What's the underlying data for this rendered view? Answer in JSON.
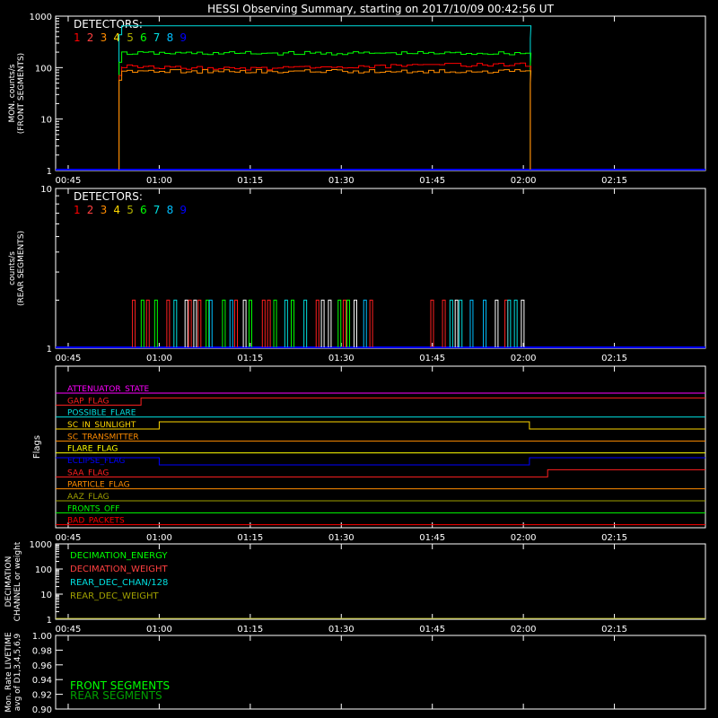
{
  "title": "HESSI Observing Summary, starting on 2017/10/09 00:42:56 UT",
  "colors": {
    "background": "#000000",
    "axes": "#ffffff",
    "baseline": "#0000ff",
    "det": [
      "#ff0000",
      "#ff4040",
      "#ff8c00",
      "#ffd700",
      "#b0b000",
      "#00ff00",
      "#00e0e0",
      "#00bfff",
      "#0000ff"
    ]
  },
  "time_ticks": [
    "00:45",
    "01:00",
    "01:15",
    "01:30",
    "01:45",
    "02:00",
    "02:15"
  ],
  "chart_data": [
    {
      "type": "line",
      "panel": "front",
      "ylabel": "MON. counts/s (FRONT SEGMENTS)",
      "yscale": "log",
      "ylim": [
        1,
        1000
      ],
      "yticks": [
        "1",
        "10",
        "100",
        "1000"
      ],
      "xlim": [
        "00:42:56",
        "02:30:00"
      ],
      "legend_title": "DETECTORS:",
      "legend_numbers": [
        "1",
        "2",
        "3",
        "4",
        "5",
        "6",
        "7",
        "8",
        "9"
      ],
      "legend_position": "top-left",
      "grid": false,
      "data_window": [
        "00:55",
        "02:01"
      ],
      "series": [
        {
          "name": "8",
          "color": "#00e0e0",
          "level": 650
        },
        {
          "name": "6",
          "color": "#00ff00",
          "level": 190
        },
        {
          "name": "1",
          "color": "#ff0000",
          "level": 105
        },
        {
          "name": "3",
          "color": "#ff8c00",
          "level": 85
        }
      ]
    },
    {
      "type": "line",
      "panel": "rear",
      "ylabel": "counts/s (REAR SEGMENTS)",
      "yscale": "log",
      "ylim": [
        1,
        10
      ],
      "yticks": [
        "1",
        "10"
      ],
      "legend_title": "DETECTORS:",
      "legend_numbers": [
        "1",
        "2",
        "3",
        "4",
        "5",
        "6",
        "7",
        "8",
        "9"
      ],
      "legend_position": "top-left",
      "spike_level": 2,
      "spike_window": [
        "00:55",
        "02:01"
      ]
    },
    {
      "type": "line",
      "panel": "flags",
      "ylabel": "Flags",
      "flags": [
        {
          "label": "ATTENUATOR_STATE",
          "color": "#ff00ff",
          "steps": []
        },
        {
          "label": "GAP_FLAG",
          "color": "#ff2020",
          "steps": [
            [
              "00:45",
              0
            ],
            [
              "00:57",
              1
            ],
            [
              "02:02",
              1
            ]
          ]
        },
        {
          "label": "POSSIBLE_FLARE",
          "color": "#00e0e0",
          "steps": []
        },
        {
          "label": "SC_IN_SUNLIGHT",
          "color": "#ffd700",
          "steps": [
            [
              "00:45",
              0
            ],
            [
              "01:00",
              1
            ],
            [
              "02:01",
              0
            ]
          ]
        },
        {
          "label": "SC_TRANSMITTER",
          "color": "#ff8c00",
          "steps": []
        },
        {
          "label": "FLARE_FLAG",
          "color": "#ffff00",
          "steps": []
        },
        {
          "label": "ECLIPSE_FLAG",
          "color": "#0000ff",
          "steps": [
            [
              "00:45",
              1
            ],
            [
              "01:00",
              0
            ],
            [
              "02:01",
              1
            ]
          ]
        },
        {
          "label": "SAA_FLAG",
          "color": "#ff2020",
          "steps": [
            [
              "00:45",
              0
            ],
            [
              "02:04",
              1
            ]
          ]
        },
        {
          "label": "PARTICLE_FLAG",
          "color": "#ff8c00",
          "steps": [
            [
              "00:45",
              0
            ]
          ]
        },
        {
          "label": "AAZ_FLAG",
          "color": "#a0a000",
          "steps": [
            [
              "00:45",
              0
            ]
          ]
        },
        {
          "label": "FRONTS_OFF",
          "color": "#00ff00",
          "steps": []
        },
        {
          "label": "BAD_PACKETS",
          "color": "#ff0000",
          "steps": []
        }
      ]
    },
    {
      "type": "line",
      "panel": "decimation",
      "ylabel": "DECIMATION CHANNEL or weight",
      "yscale": "log",
      "ylim": [
        1,
        1000
      ],
      "yticks": [
        "1",
        "10",
        "100",
        "1000"
      ],
      "legend": [
        {
          "label": "DECIMATION_ENERGY",
          "color": "#00ff00"
        },
        {
          "label": "DECIMATION_WEIGHT",
          "color": "#ff4040"
        },
        {
          "label": "REAR_DEC_CHAN/128",
          "color": "#00e0e0"
        },
        {
          "label": "REAR_DEC_WEIGHT",
          "color": "#a0a000"
        }
      ]
    },
    {
      "type": "line",
      "panel": "livetime",
      "ylabel": "Mon. Rate LIVETIME avg of D1,3,4,5,6,9",
      "ylim": [
        0.9,
        1.0
      ],
      "yticks": [
        "1.00",
        "0.98",
        "0.96",
        "0.94",
        "0.92",
        "0.90"
      ],
      "legend": [
        {
          "label": "FRONT SEGMENTS",
          "color": "#00ff00"
        },
        {
          "label": "REAR SEGMENTS",
          "color": "#00a000"
        }
      ]
    }
  ]
}
